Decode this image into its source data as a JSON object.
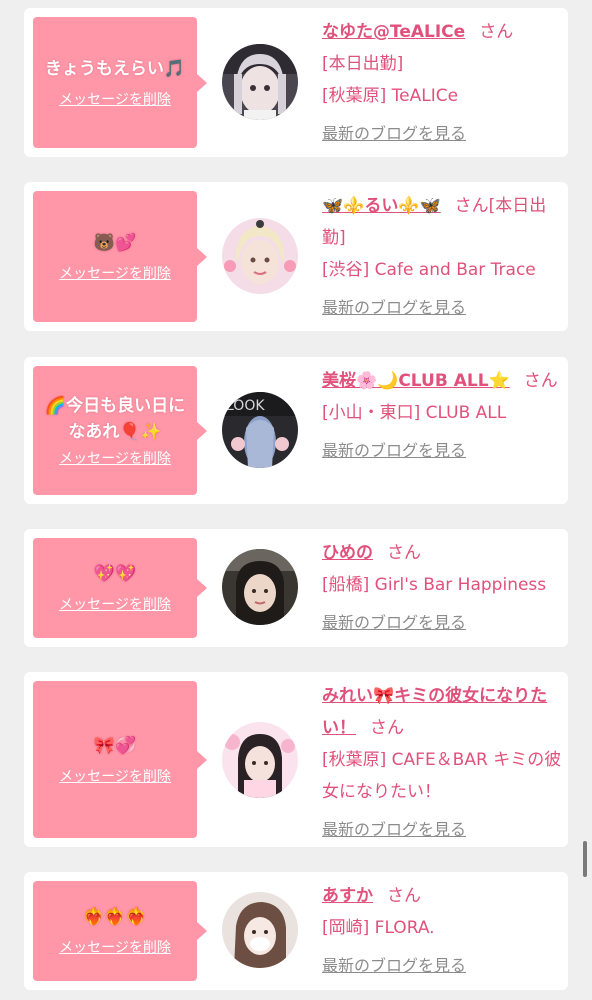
{
  "entries": [
    {
      "message": "きょうもえらい🎵",
      "delete_label": "メッセージを削除",
      "name": "なゆた@TeALICe",
      "suffix": "さん",
      "lines": [
        "[本日出勤]",
        "[秋葉原] TeALICe"
      ],
      "blog_label": "最新のブログを見る"
    },
    {
      "message": "🐻💕",
      "delete_label": "メッセージを削除",
      "name": "🦋⚜️るい⚜️🦋",
      "suffix": "さん[本日出勤]",
      "lines": [
        "[渋谷] Cafe and Bar Trace"
      ],
      "blog_label": "最新のブログを見る"
    },
    {
      "message": "🌈今日も良い日になあれ🎈✨",
      "delete_label": "メッセージを削除",
      "name": "美桜🌸🌙CLUB ALL⭐",
      "suffix": "さん",
      "lines": [
        "[小山・東口] CLUB ALL"
      ],
      "blog_label": "最新のブログを見る"
    },
    {
      "message": "💖💖",
      "delete_label": "メッセージを削除",
      "name": "ひめの",
      "suffix": "さん",
      "lines": [
        "[船橋] Girl's Bar Happiness"
      ],
      "blog_label": "最新のブログを見る"
    },
    {
      "message": "🎀💞",
      "delete_label": "メッセージを削除",
      "name": "みれい🎀キミの彼女になりたい！",
      "suffix": "さん",
      "lines": [
        "[秋葉原] CAFE＆BAR キミの彼女になりたい！"
      ],
      "blog_label": "最新のブログを見る"
    },
    {
      "message": "❤️‍🔥❤️‍🔥❤️‍🔥",
      "delete_label": "メッセージを削除",
      "name": "あすか",
      "suffix": "さん",
      "lines": [
        "[岡崎] FLORA."
      ],
      "blog_label": "最新のブログを見る"
    }
  ],
  "colors": {
    "background": "#efefef",
    "card": "#ffffff",
    "message_box": "#ff97a8",
    "name": "#e0517c",
    "blog_link": "#8c8c8c"
  }
}
